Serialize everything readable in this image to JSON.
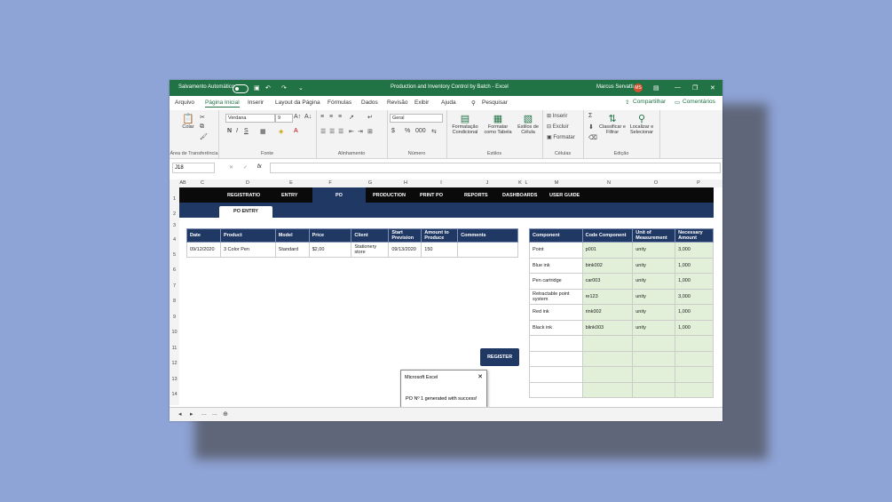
{
  "titlebar": {
    "autosave_label": "Salvamento Automático",
    "doc_title": "Production and Inventory Control by Batch  -  Excel",
    "user_name": "Marcus Servatti",
    "user_initials": "MS"
  },
  "menu": {
    "tabs": [
      "Arquivo",
      "Página Inicial",
      "Inserir",
      "Layout da Página",
      "Fórmulas",
      "Dados",
      "Revisão",
      "Exibir",
      "Ajuda"
    ],
    "search": "Pesquisar",
    "share": "Compartilhar",
    "comments": "Comentários"
  },
  "ribbon": {
    "paste": "Colar",
    "clipboard": "Área de Transferência",
    "font_name": "Verdana",
    "font_size": "9",
    "font_group": "Fonte",
    "align_group": "Alinhamento",
    "number_format": "Geral",
    "number_group": "Número",
    "cond_format": "Formatação Condicional",
    "format_table": "Formatar como Tabela",
    "cell_styles": "Estilos de Célula",
    "styles_group": "Estilos",
    "insert": "Inserir",
    "delete": "Excluir",
    "format": "Formatar",
    "cells_group": "Células",
    "sort_filter": "Classificar e Filtrar",
    "find_select": "Localizar e Selecionar",
    "edit_group": "Edição"
  },
  "formula_bar": {
    "name_box": "J18",
    "fx": "fx"
  },
  "columns": [
    "AB",
    "C",
    "D",
    "E",
    "F",
    "G",
    "H",
    "I",
    "J",
    "K",
    "L",
    "M",
    "N",
    "O",
    "P"
  ],
  "rows": [
    "1",
    "2",
    "3",
    "4",
    "5",
    "6",
    "7",
    "8",
    "9",
    "10",
    "11",
    "12",
    "13",
    "14"
  ],
  "nav": {
    "items": [
      "REGISTRATIO",
      "ENTRY",
      "PO",
      "PRODUCTION",
      "PRINT PO",
      "REPORTS",
      "DASHBOARDS",
      "USER GUIDE"
    ],
    "subtab": "PO ENTRY"
  },
  "po_table": {
    "headers": [
      "Date",
      "Product",
      "Model",
      "Price",
      "Client",
      "Start Prevision",
      "Amount to Produce",
      "Comments"
    ],
    "row": [
      "09/12/2020",
      "3 Color Pen",
      "Standard",
      "$2,00",
      "Stationery store",
      "09/13/2020",
      "150",
      ""
    ]
  },
  "register_button": "REGISTER",
  "component_table": {
    "headers": [
      "Component",
      "Code Component",
      "Unit of Measurement",
      "Necessary Amount"
    ],
    "rows": [
      [
        "Point",
        "p001",
        "unity",
        "3,000"
      ],
      [
        "Blue ink",
        "bink002",
        "unity",
        "1,000"
      ],
      [
        "Pen cartridge",
        "car003",
        "unity",
        "1,000"
      ],
      [
        "Retractable point system",
        "re123",
        "unity",
        "3,000"
      ],
      [
        "Red ink",
        "rink002",
        "unity",
        "1,000"
      ],
      [
        "Black ink",
        "blink003",
        "unity",
        "1,000"
      ]
    ]
  },
  "dialog": {
    "title": "Microsoft Excel",
    "message": "PO Nº 1 generated with success!",
    "ok": "OK"
  },
  "sheet_tabs": {
    "dots1": "...",
    "dots2": "..."
  }
}
